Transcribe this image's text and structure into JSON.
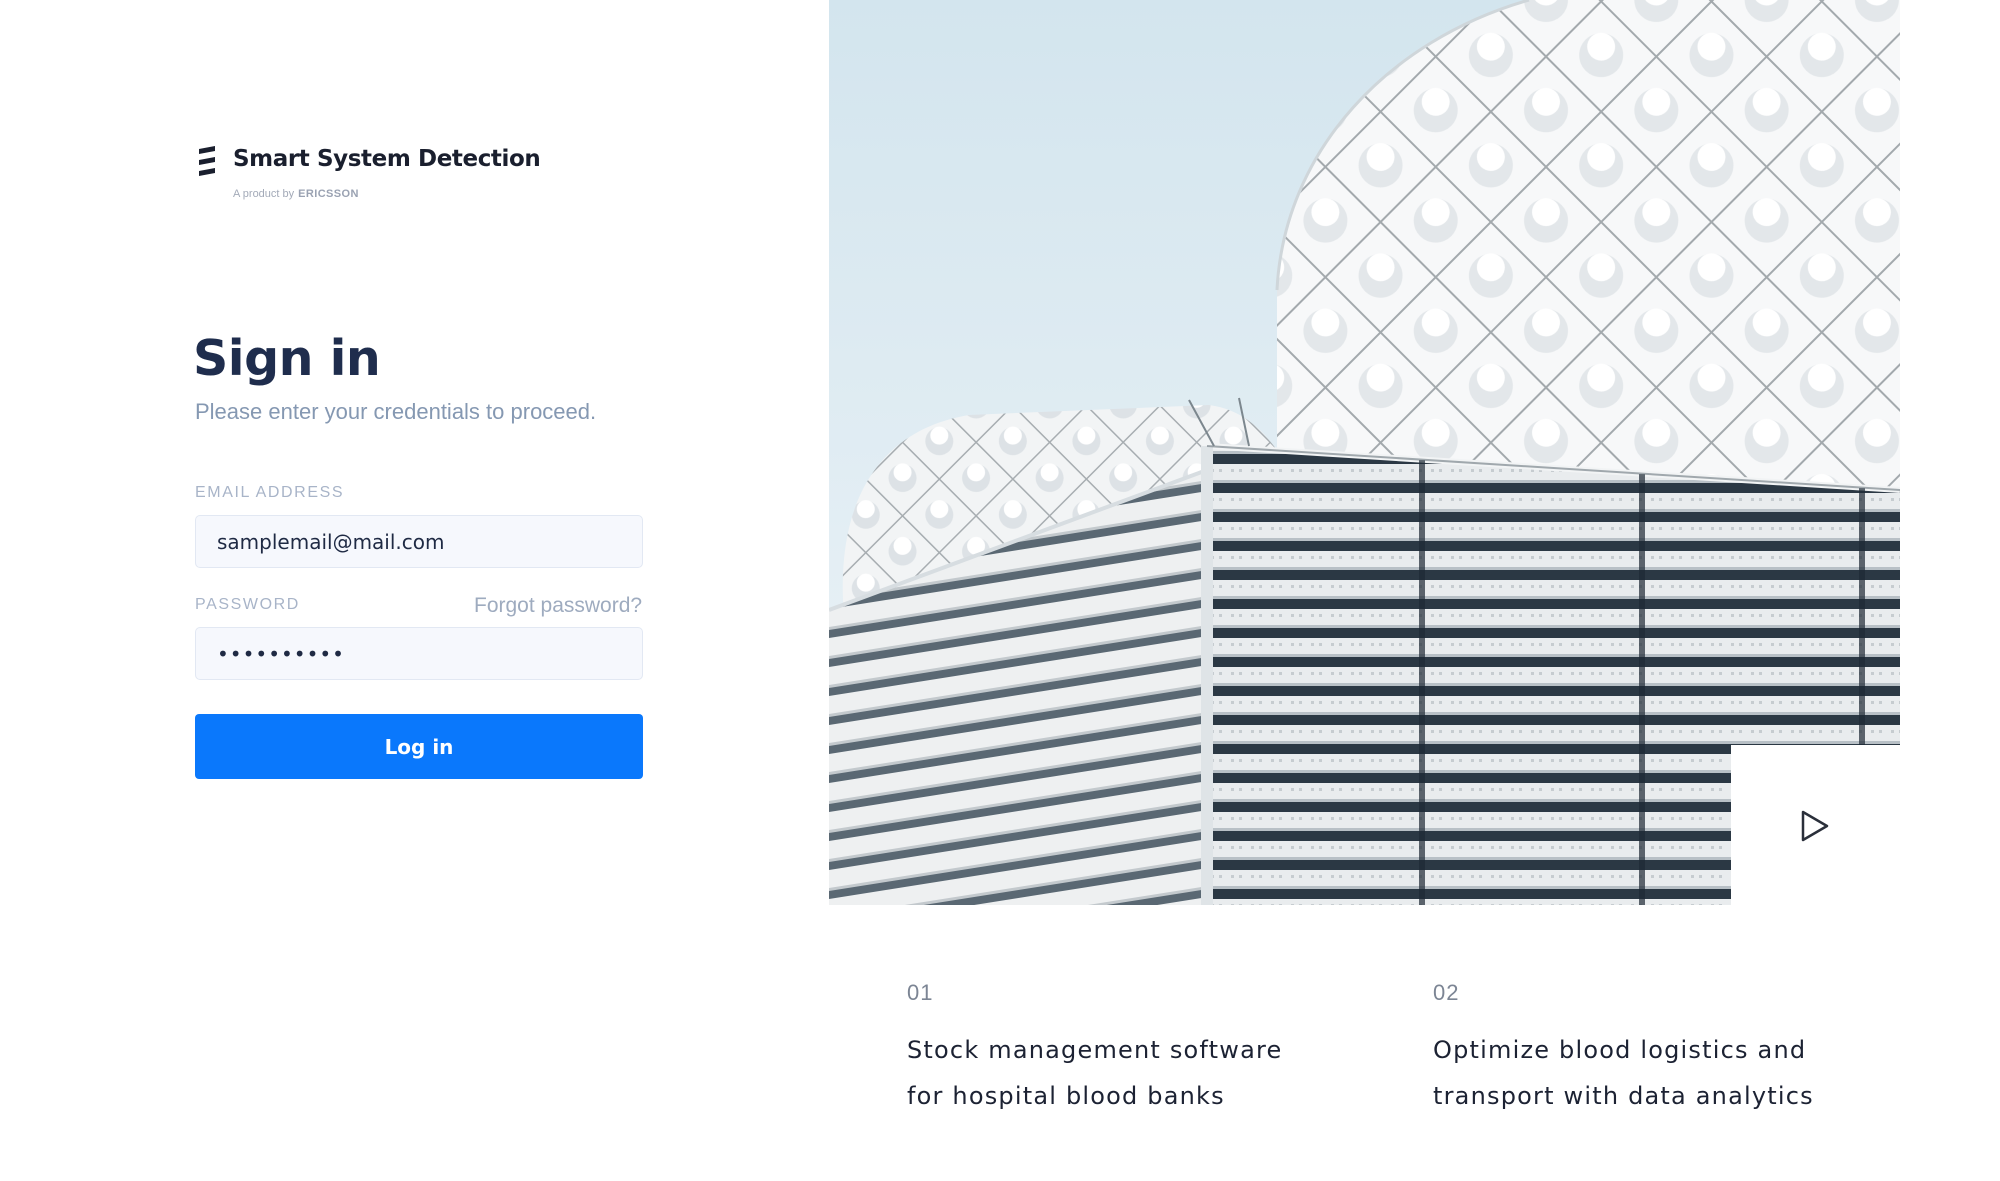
{
  "brand": {
    "name": "Smart System Detection",
    "tagline": "A product by",
    "company": "ERICSSON"
  },
  "signin": {
    "title": "Sign in",
    "subtitle": "Please enter your credentials to proceed.",
    "email_label": "EMAIL ADDRESS",
    "email_value": "samplemail@mail.com",
    "password_label": "PASSWORD",
    "password_value": "••••••••••",
    "forgot_link": "Forgot password?",
    "login_button": "Log in"
  },
  "hero": {
    "image_icon": "building-photo",
    "play_icon": "play-icon"
  },
  "features": [
    {
      "number": "01",
      "text": "Stock management software for hospital blood banks"
    },
    {
      "number": "02",
      "text": "Optimize blood logistics and transport with data analytics"
    }
  ],
  "colors": {
    "primary": "#0a78fc",
    "heading": "#1f2d4d",
    "muted": "#8598b2",
    "input_bg": "#f6f8fd",
    "sky": "#d9e8f0"
  }
}
